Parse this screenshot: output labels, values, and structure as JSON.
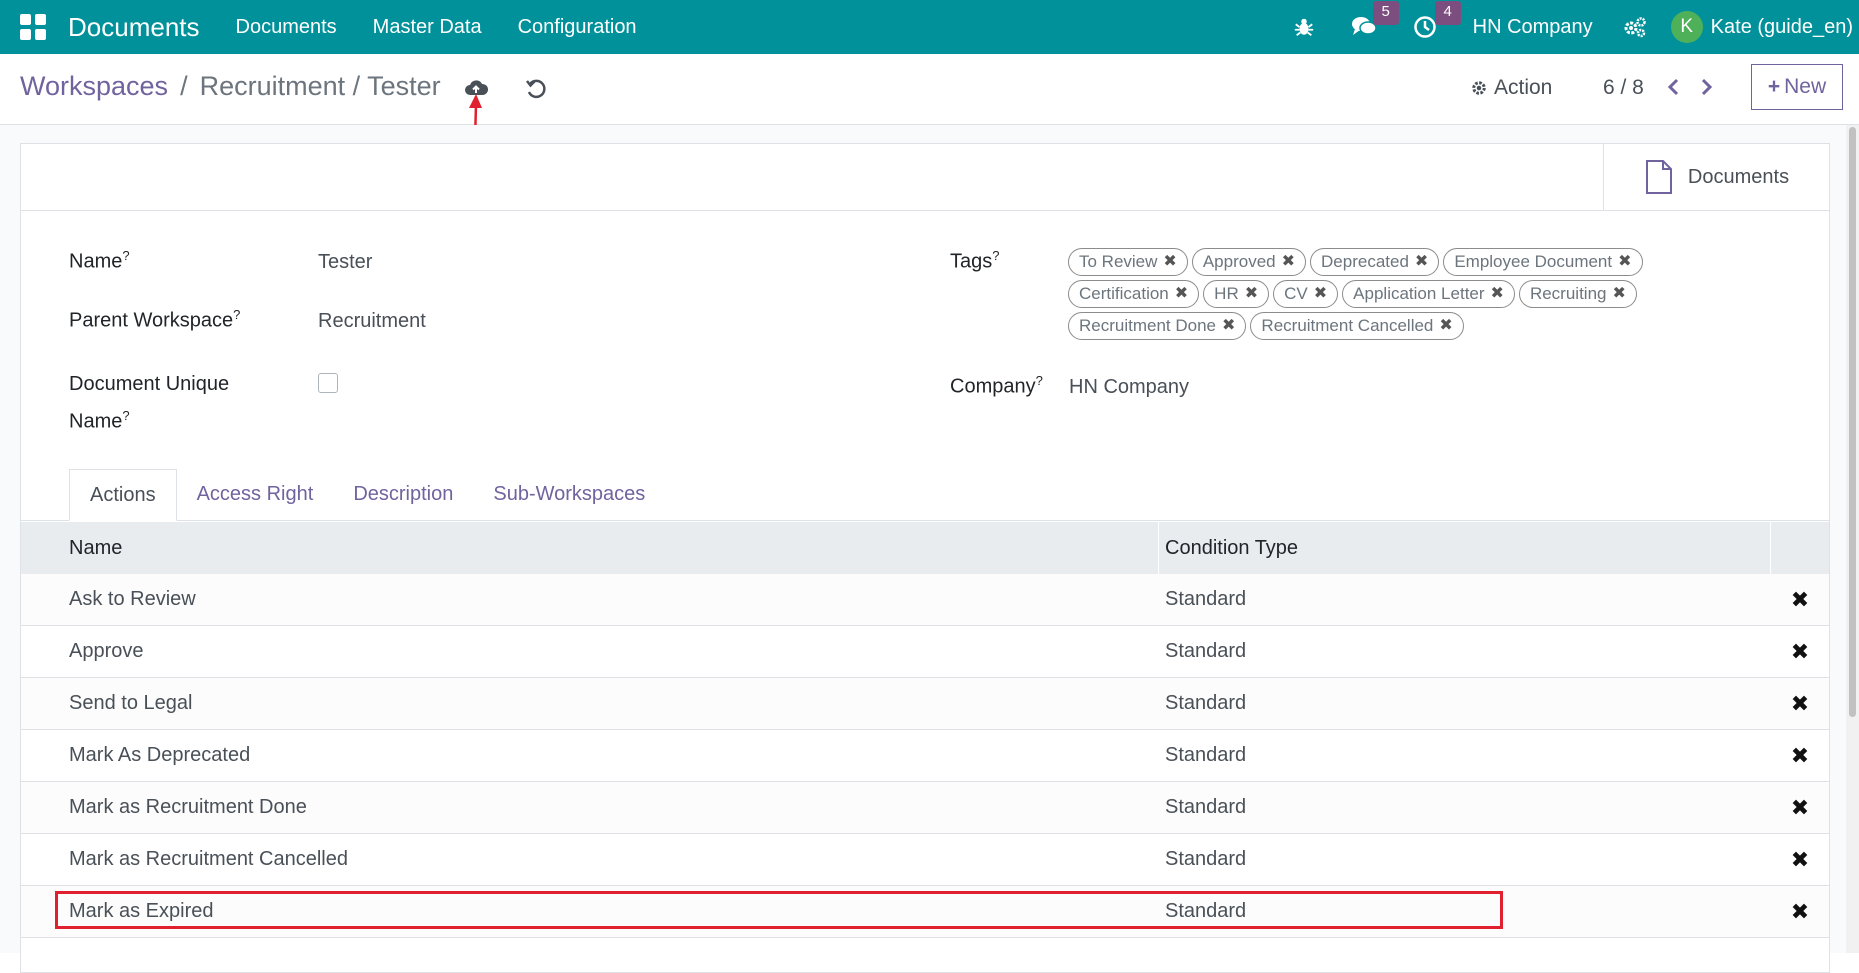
{
  "topbar": {
    "app_title": "Documents",
    "menus": [
      "Documents",
      "Master Data",
      "Configuration"
    ],
    "messages_count": "5",
    "activities_count": "4",
    "company": "HN Company",
    "avatar_initial": "K",
    "user": "Kate (guide_en)"
  },
  "breadcrumb": {
    "root": "Workspaces",
    "separator": "/",
    "current": "Recruitment / Tester"
  },
  "controls": {
    "action_label": "Action",
    "pager": "6 / 8",
    "new_label": "New"
  },
  "smart_button": {
    "label": "Documents"
  },
  "form": {
    "name_label": "Name",
    "name_value": "Tester",
    "parent_label": "Parent Workspace",
    "parent_value": "Recruitment",
    "unique_label_1": "Document Unique",
    "unique_label_2": "Name",
    "unique_checked": false,
    "tags_label": "Tags",
    "tags": [
      "To Review",
      "Approved",
      "Deprecated",
      "Employee Document",
      "Certification",
      "HR",
      "CV",
      "Application Letter",
      "Recruiting",
      "Recruitment Done",
      "Recruitment Cancelled"
    ],
    "company_label": "Company",
    "company_value": "HN Company",
    "help_mark": "?"
  },
  "tabs": [
    "Actions",
    "Access Right",
    "Description",
    "Sub-Workspaces"
  ],
  "table": {
    "columns": [
      "Name",
      "Condition Type"
    ],
    "rows": [
      {
        "name": "Ask to Review",
        "condition": "Standard"
      },
      {
        "name": "Approve",
        "condition": "Standard"
      },
      {
        "name": "Send to Legal",
        "condition": "Standard"
      },
      {
        "name": "Mark As Deprecated",
        "condition": "Standard"
      },
      {
        "name": "Mark as Recruitment Done",
        "condition": "Standard"
      },
      {
        "name": "Mark as Recruitment Cancelled",
        "condition": "Standard"
      },
      {
        "name": "Mark as Expired",
        "condition": "Standard"
      }
    ]
  },
  "colors": {
    "topbar": "#00919a",
    "accent": "#71639e",
    "annotation": "#e0202e"
  }
}
